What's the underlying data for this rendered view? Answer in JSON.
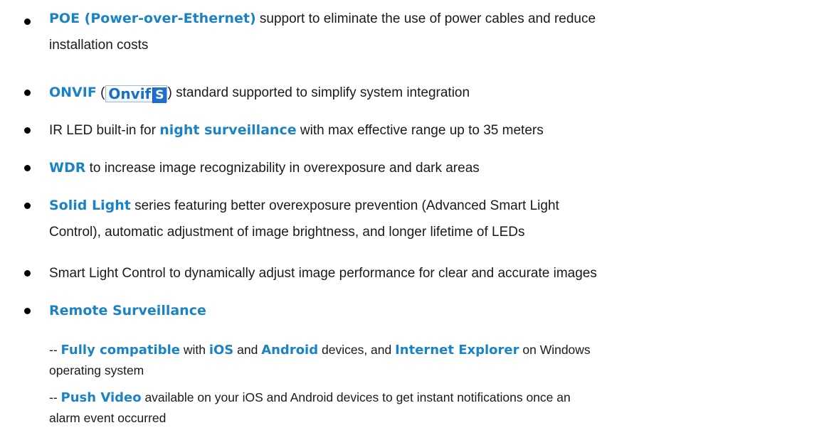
{
  "features": [
    {
      "highlight": "POE (Power-over-Ethernet)",
      "rest_line1": " support to eliminate the use of power cables and reduce",
      "line2": "installation costs"
    },
    {
      "highlight": "ONVIF",
      "open_paren": " (",
      "logo_word": "Onvif",
      "logo_badge": "S",
      "rest": ") standard supported to simplify system integration"
    },
    {
      "pre": "IR LED built-in for ",
      "highlight": "night surveillance",
      "rest": " with max effective range up to 35 meters"
    },
    {
      "highlight": "WDR",
      "rest": " to increase image recognizability in overexposure and dark areas"
    },
    {
      "highlight": "Solid Light",
      "rest_line1": " series featuring better overexposure prevention (Advanced Smart Light",
      "line2": "Control), automatic adjustment of image brightness, and longer lifetime of LEDs"
    },
    {
      "text": "Smart Light Control to dynamically adjust image performance for clear and accurate images"
    },
    {
      "highlight": "Remote Surveillance"
    }
  ],
  "remote": {
    "item1": {
      "dash": "-- ",
      "h1": "Fully compatible",
      "t1": " with ",
      "h2": "iOS",
      "t2": " and ",
      "h3": "Android",
      "t3": " devices, and ",
      "h4": "Internet Explorer",
      "t4": " on Windows",
      "line2": "operating system"
    },
    "item2": {
      "dash": "-- ",
      "h1": "Push Video",
      "t1": " available on your iOS and Android devices to get instant notifications once an",
      "line2": "alarm event occurred"
    }
  },
  "colors": {
    "highlight": "#1a83c6",
    "text": "#1a1a1a",
    "bullet": "#000000"
  }
}
